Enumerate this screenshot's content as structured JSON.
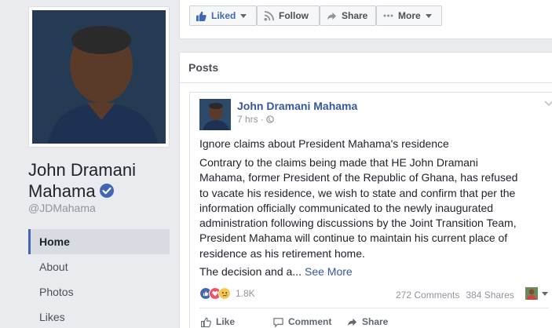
{
  "profile": {
    "name": "John Dramani Mahama",
    "handle": "@JDMahama",
    "verified_icon": "verified-badge-icon",
    "accent_color": "#4267b2"
  },
  "nav": {
    "items": [
      {
        "label": "Home",
        "active": true
      },
      {
        "label": "About",
        "active": false
      },
      {
        "label": "Photos",
        "active": false
      },
      {
        "label": "Likes",
        "active": false
      }
    ]
  },
  "action_bar": {
    "liked_label": "Liked",
    "follow_label": "Follow",
    "share_label": "Share",
    "more_label": "More"
  },
  "posts": {
    "header": "Posts",
    "post": {
      "author": "John Dramani Mahama",
      "time": "7 hrs",
      "privacy_icon": "globe-icon",
      "title": "Ignore claims about President Mahama's residence",
      "body": "Contrary to the claims being made that HE John Dramani Mahama, former President of the Republic of Ghana, has refused to vacate his residence, we wish to state and confirm that per the information officially communicated to the newly inaugurated administration following discussions by the Joint Transition Team, President Mahama will continue to maintain his current place of residence as his retirement home.",
      "truncated": "The decision and a...",
      "see_more": "See More",
      "reactions_count": "1.8K",
      "comments": "272 Comments",
      "shares": "384 Shares",
      "actions": {
        "like": "Like",
        "comment": "Comment",
        "share": "Share"
      }
    }
  }
}
